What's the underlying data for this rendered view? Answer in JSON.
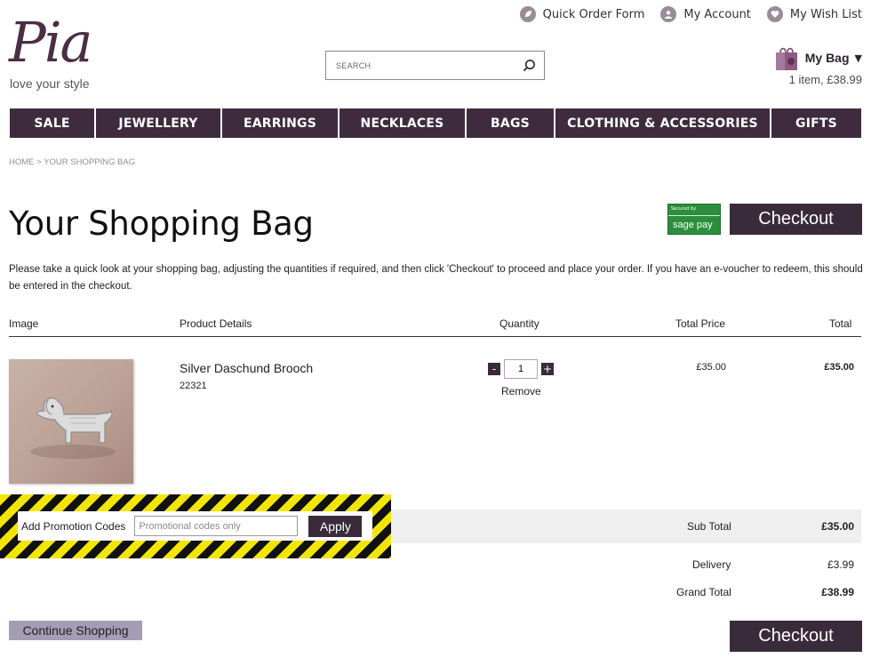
{
  "brand": {
    "logo_text": "Pia",
    "tagline": "love your style",
    "accent": "#3e2c3e"
  },
  "toplinks": [
    {
      "label": "Quick Order Form",
      "icon": "leaf-icon"
    },
    {
      "label": "My Account",
      "icon": "user-icon"
    },
    {
      "label": "My Wish List",
      "icon": "heart-icon"
    }
  ],
  "search": {
    "placeholder": "SEARCH"
  },
  "bag": {
    "title": "My Bag",
    "caret": "▼",
    "summary": "1 item, £38.99"
  },
  "nav": [
    "SALE",
    "JEWELLERY",
    "EARRINGS",
    "NECKLACES",
    "BAGS",
    "CLOTHING & ACCESSORIES",
    "GIFTS"
  ],
  "breadcrumb": "HOME > YOUR SHOPPING BAG",
  "page_title": "Your Shopping Bag",
  "sagepay": {
    "secured_by": "Secured by",
    "logo": "sage pay"
  },
  "checkout_label": "Checkout",
  "intro": "Please take a quick look at your shopping bag, adjusting the quantities if required, and then click 'Checkout' to proceed and place your order. If you have an e-voucher to redeem, this should be entered in the checkout.",
  "table": {
    "headers": {
      "image": "Image",
      "details": "Product Details",
      "quantity": "Quantity",
      "total_price": "Total Price",
      "total": "Total"
    },
    "item": {
      "name": "Silver Daschund Brooch",
      "code": "22321",
      "qty": "1",
      "minus": "-",
      "plus": "+",
      "remove": "Remove",
      "unit_total": "£35.00",
      "line_total": "£35.00"
    }
  },
  "promo": {
    "label": "Add Promotion Codes",
    "placeholder": "Promotional codes only",
    "apply": "Apply"
  },
  "totals": {
    "subtotal_label": "Sub Total",
    "subtotal": "£35.00",
    "delivery_label": "Delivery",
    "delivery": "£3.99",
    "grand_label": "Grand Total",
    "grand": "£38.99"
  },
  "continue_label": "Continue Shopping"
}
